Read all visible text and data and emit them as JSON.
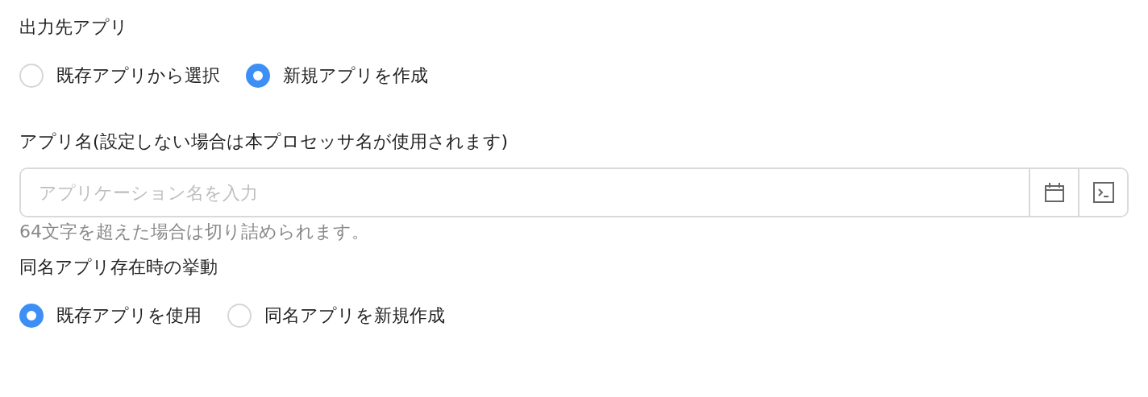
{
  "output_app": {
    "label": "出力先アプリ",
    "options": [
      {
        "label": "既存アプリから選択",
        "selected": false
      },
      {
        "label": "新規アプリを作成",
        "selected": true
      }
    ]
  },
  "app_name": {
    "label": "アプリ名(設定しない場合は本プロセッサ名が使用されます)",
    "placeholder": "アプリケーション名を入力",
    "hint": "64文字を超えた場合は切り詰められます。"
  },
  "same_name_behavior": {
    "label": "同名アプリ存在時の挙動",
    "options": [
      {
        "label": "既存アプリを使用",
        "selected": true
      },
      {
        "label": "同名アプリを新規作成",
        "selected": false
      }
    ]
  }
}
